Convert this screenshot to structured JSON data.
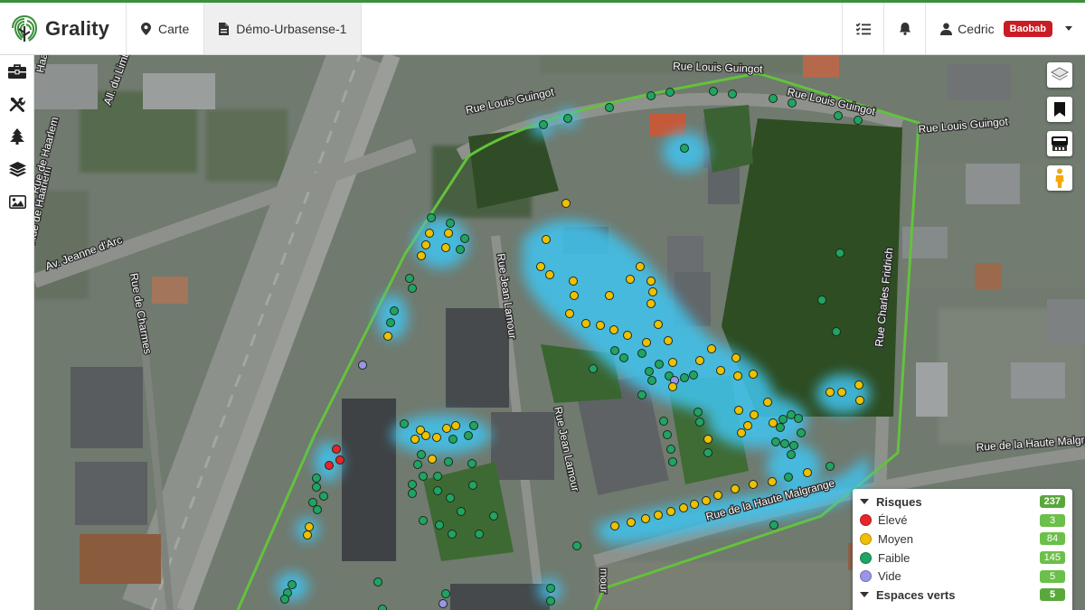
{
  "app": {
    "name": "Grality",
    "accent_color": "#3a8f3a"
  },
  "nav": {
    "items": [
      {
        "label": "Carte",
        "icon": "map-marker-icon"
      },
      {
        "label": "Démo-Urbasense-1",
        "icon": "file-icon"
      }
    ]
  },
  "top_icons": [
    "task-list-icon",
    "bell-icon"
  ],
  "user": {
    "name": "Cedric",
    "badge": "Baobab",
    "badge_color": "#c81d25"
  },
  "sidebar": {
    "tools": [
      "toolbox-icon",
      "tools-icon",
      "tree-icon",
      "layers-icon",
      "image-icon"
    ]
  },
  "map": {
    "streets": [
      "Rue Louis Guingot",
      "Rue Louis Guingot",
      "Rue Louis Guingot",
      "Rue Louis Guingot",
      "Rue Jean Lamour",
      "Rue Jean Lamour",
      "Rue Charles Fridrich",
      "Rue de la Haute Malgrange",
      "Rue de la Haute Malgrange",
      "Av. Jeanne d'Arc",
      "Rue de Charmes",
      "Rue de Haarlem",
      "Rue de Haarlem",
      "Haarlem",
      "All. du Limbourg",
      "mour"
    ],
    "controls": [
      "basemap-layers-icon",
      "bookmark-icon",
      "road-view-icon",
      "street-view-pegman-icon"
    ],
    "colors": {
      "eleve": "#e8242b",
      "moyen": "#f0c000",
      "faible": "#1fa463",
      "vide": "#9b95e8",
      "heat": "#3fc4f0",
      "perimeter": "#63c23c"
    }
  },
  "legend": {
    "sections": [
      {
        "title": "Risques",
        "total": "237",
        "items": [
          {
            "label": "Élevé",
            "count": "3",
            "color": "#e8242b"
          },
          {
            "label": "Moyen",
            "count": "84",
            "color": "#f0c000"
          },
          {
            "label": "Faible",
            "count": "145",
            "color": "#1fa463"
          },
          {
            "label": "Vide",
            "count": "5",
            "color": "#9b95e8"
          }
        ]
      },
      {
        "title": "Espaces verts",
        "total": "5"
      }
    ]
  }
}
